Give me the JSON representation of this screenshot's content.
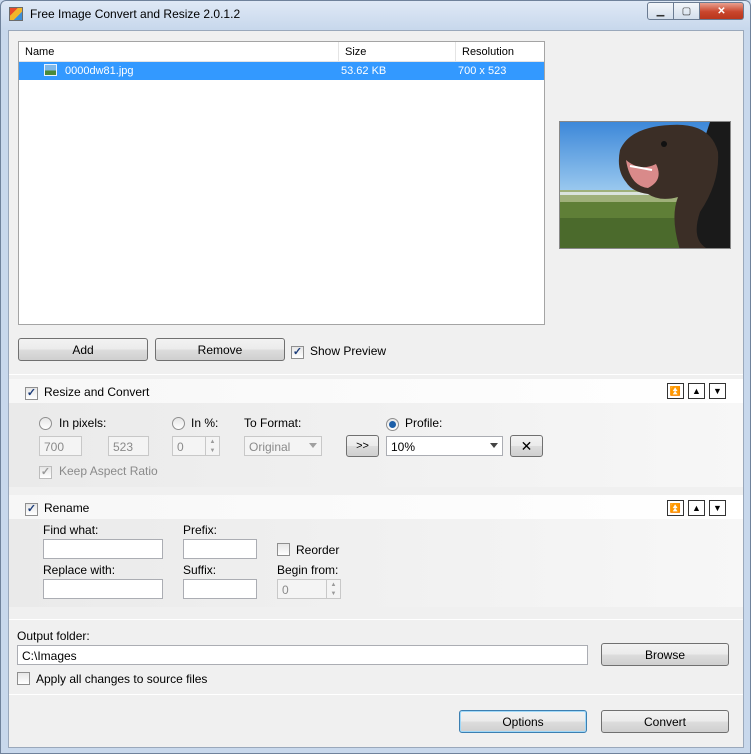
{
  "window": {
    "title": "Free Image Convert and Resize 2.0.1.2",
    "controls": {
      "minimize": "▁",
      "maximize": "▢",
      "close": "✕"
    }
  },
  "file_list": {
    "columns": [
      "Name",
      "Size",
      "Resolution"
    ],
    "rows": [
      {
        "name": "0000dw81.jpg",
        "size": "53.62 KB",
        "resolution": "700 x 523",
        "selected": true
      }
    ]
  },
  "actions": {
    "add": "Add",
    "remove": "Remove",
    "show_preview": "Show Preview",
    "show_preview_checked": true
  },
  "resize": {
    "section_label": "Resize and Convert",
    "enabled": true,
    "in_pixels_label": "In pixels:",
    "in_percent_label": "In %:",
    "to_format_label": "To Format:",
    "profile_label": "Profile:",
    "width": "700",
    "height": "523",
    "percent": "0",
    "format": "Original",
    "apply_button": ">>",
    "profile": "10%",
    "keep_aspect_label": "Keep Aspect Ratio",
    "keep_aspect_checked": true,
    "selected_mode": "profile"
  },
  "rename": {
    "section_label": "Rename",
    "enabled": true,
    "find_label": "Find what:",
    "find_value": "",
    "prefix_label": "Prefix:",
    "prefix_value": "",
    "reorder_label": "Reorder",
    "reorder_checked": false,
    "replace_label": "Replace with:",
    "replace_value": "",
    "suffix_label": "Suffix:",
    "suffix_value": "",
    "begin_label": "Begin from:",
    "begin_value": "0"
  },
  "output": {
    "folder_label": "Output folder:",
    "folder_value": "C:\\Images",
    "browse": "Browse",
    "apply_all_label": "Apply all changes to source files",
    "apply_all_checked": false
  },
  "footer": {
    "options": "Options",
    "convert": "Convert"
  },
  "icons": {
    "move_top": "⏫",
    "move_up": "▲",
    "move_down": "▼",
    "clear": "✕",
    "check": "✓"
  },
  "colors": {
    "selection": "#3399ff",
    "window_frame": "#c8d8ec"
  }
}
